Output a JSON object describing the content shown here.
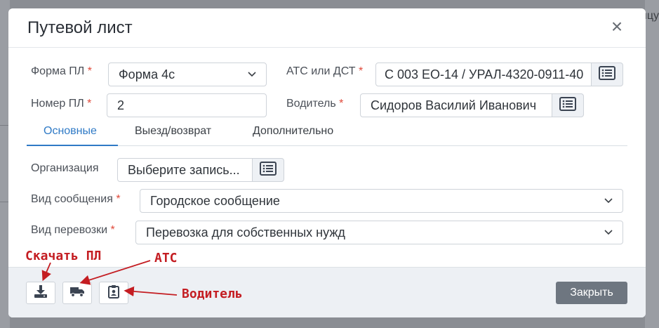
{
  "background": {
    "right_text": "ицу"
  },
  "modal": {
    "title": "Путевой лист",
    "close_symbol": "×"
  },
  "form": {
    "form_pl": {
      "label": "Форма ПЛ",
      "required": "*",
      "value": "Форма 4с"
    },
    "nomer_pl": {
      "label": "Номер ПЛ",
      "required": "*",
      "value": "2"
    },
    "ats": {
      "label": "АТС или ДСТ",
      "required": "*",
      "value": "С 003 ЕО-14 / УРАЛ-4320-0911-40"
    },
    "driver": {
      "label": "Водитель",
      "required": "*",
      "value": "Сидоров Василий Иванович"
    }
  },
  "tabs": [
    {
      "label": "Основные",
      "active": true
    },
    {
      "label": "Выезд/возврат",
      "active": false
    },
    {
      "label": "Дополнительно",
      "active": false
    }
  ],
  "main": {
    "organization": {
      "label": "Организация",
      "placeholder": "Выберите запись..."
    },
    "message_type": {
      "label": "Вид сообщения",
      "required": "*",
      "value": "Городское сообщение"
    },
    "transport_type": {
      "label": "Вид перевозки",
      "required": "*",
      "value": "Перевозка для собственных нужд"
    }
  },
  "footer": {
    "close_label": "Закрыть",
    "buttons": [
      {
        "icon": "download-icon"
      },
      {
        "icon": "truck-icon"
      },
      {
        "icon": "id-badge-icon"
      }
    ]
  },
  "annotations": {
    "download": "Скачать ПЛ",
    "ats": "АТС",
    "driver": "Водитель"
  },
  "colors": {
    "accent": "#2f7ac6",
    "required": "#e04a3b",
    "annotation": "#c41d22",
    "close_button": "#6e7680"
  }
}
